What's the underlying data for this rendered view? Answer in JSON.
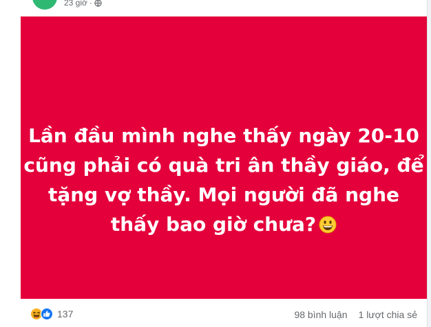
{
  "post": {
    "time": "23 giờ",
    "separator": "·",
    "privacy_icon": "globe-icon",
    "background_color": "#e4003b",
    "text_lines": [
      "Lần đầu mình nghe thấy ngày 20-10",
      "cũng phải có quà tri ân thầy giáo, để",
      "tặng vợ thầy. Mọi người đã nghe",
      "thấy bao giờ chưa?"
    ],
    "emoji": "grinning-face-icon"
  },
  "reactions": {
    "icons": [
      "haha-icon",
      "like-icon"
    ],
    "count": "137"
  },
  "stats": {
    "comments": "98 bình luận",
    "shares": "1 lượt chia sẻ"
  }
}
